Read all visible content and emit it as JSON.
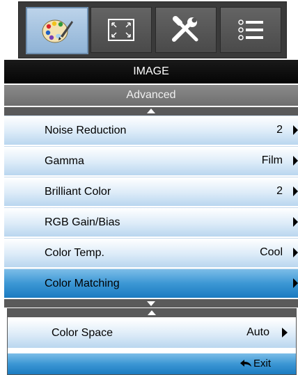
{
  "tabs": [
    {
      "name": "image",
      "icon": "palette-icon",
      "active": true
    },
    {
      "name": "display",
      "icon": "screen-resize-icon",
      "active": false
    },
    {
      "name": "setup",
      "icon": "tools-icon",
      "active": false
    },
    {
      "name": "options",
      "icon": "list-icon",
      "active": false
    }
  ],
  "menu": {
    "title": "IMAGE",
    "subtitle": "Advanced",
    "items": [
      {
        "label": "Noise Reduction",
        "value": "2"
      },
      {
        "label": "Gamma",
        "value": "Film"
      },
      {
        "label": "Brilliant Color",
        "value": "2"
      },
      {
        "label": "RGB Gain/Bias",
        "value": ""
      },
      {
        "label": "Color Temp.",
        "value": "Cool"
      },
      {
        "label": "Color Matching",
        "value": ""
      }
    ]
  },
  "submenu": {
    "label": "Color Space",
    "value": "Auto"
  },
  "exit_label": "Exit",
  "colors": {
    "selected": "#3c97d4",
    "title_bar": "#050505",
    "subtitle_bar": "#7a7a7a"
  }
}
